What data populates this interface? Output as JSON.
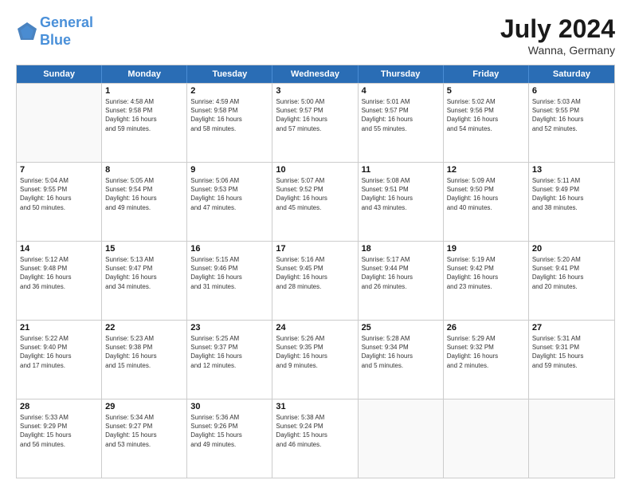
{
  "header": {
    "logo_line1": "General",
    "logo_line2": "Blue",
    "month": "July 2024",
    "location": "Wanna, Germany"
  },
  "days_of_week": [
    "Sunday",
    "Monday",
    "Tuesday",
    "Wednesday",
    "Thursday",
    "Friday",
    "Saturday"
  ],
  "weeks": [
    [
      {
        "day": "",
        "empty": true,
        "lines": []
      },
      {
        "day": "1",
        "lines": [
          "Sunrise: 4:58 AM",
          "Sunset: 9:58 PM",
          "Daylight: 16 hours",
          "and 59 minutes."
        ]
      },
      {
        "day": "2",
        "lines": [
          "Sunrise: 4:59 AM",
          "Sunset: 9:58 PM",
          "Daylight: 16 hours",
          "and 58 minutes."
        ]
      },
      {
        "day": "3",
        "lines": [
          "Sunrise: 5:00 AM",
          "Sunset: 9:57 PM",
          "Daylight: 16 hours",
          "and 57 minutes."
        ]
      },
      {
        "day": "4",
        "lines": [
          "Sunrise: 5:01 AM",
          "Sunset: 9:57 PM",
          "Daylight: 16 hours",
          "and 55 minutes."
        ]
      },
      {
        "day": "5",
        "lines": [
          "Sunrise: 5:02 AM",
          "Sunset: 9:56 PM",
          "Daylight: 16 hours",
          "and 54 minutes."
        ]
      },
      {
        "day": "6",
        "lines": [
          "Sunrise: 5:03 AM",
          "Sunset: 9:55 PM",
          "Daylight: 16 hours",
          "and 52 minutes."
        ]
      }
    ],
    [
      {
        "day": "7",
        "lines": [
          "Sunrise: 5:04 AM",
          "Sunset: 9:55 PM",
          "Daylight: 16 hours",
          "and 50 minutes."
        ]
      },
      {
        "day": "8",
        "lines": [
          "Sunrise: 5:05 AM",
          "Sunset: 9:54 PM",
          "Daylight: 16 hours",
          "and 49 minutes."
        ]
      },
      {
        "day": "9",
        "lines": [
          "Sunrise: 5:06 AM",
          "Sunset: 9:53 PM",
          "Daylight: 16 hours",
          "and 47 minutes."
        ]
      },
      {
        "day": "10",
        "lines": [
          "Sunrise: 5:07 AM",
          "Sunset: 9:52 PM",
          "Daylight: 16 hours",
          "and 45 minutes."
        ]
      },
      {
        "day": "11",
        "lines": [
          "Sunrise: 5:08 AM",
          "Sunset: 9:51 PM",
          "Daylight: 16 hours",
          "and 43 minutes."
        ]
      },
      {
        "day": "12",
        "lines": [
          "Sunrise: 5:09 AM",
          "Sunset: 9:50 PM",
          "Daylight: 16 hours",
          "and 40 minutes."
        ]
      },
      {
        "day": "13",
        "lines": [
          "Sunrise: 5:11 AM",
          "Sunset: 9:49 PM",
          "Daylight: 16 hours",
          "and 38 minutes."
        ]
      }
    ],
    [
      {
        "day": "14",
        "lines": [
          "Sunrise: 5:12 AM",
          "Sunset: 9:48 PM",
          "Daylight: 16 hours",
          "and 36 minutes."
        ]
      },
      {
        "day": "15",
        "lines": [
          "Sunrise: 5:13 AM",
          "Sunset: 9:47 PM",
          "Daylight: 16 hours",
          "and 34 minutes."
        ]
      },
      {
        "day": "16",
        "lines": [
          "Sunrise: 5:15 AM",
          "Sunset: 9:46 PM",
          "Daylight: 16 hours",
          "and 31 minutes."
        ]
      },
      {
        "day": "17",
        "lines": [
          "Sunrise: 5:16 AM",
          "Sunset: 9:45 PM",
          "Daylight: 16 hours",
          "and 28 minutes."
        ]
      },
      {
        "day": "18",
        "lines": [
          "Sunrise: 5:17 AM",
          "Sunset: 9:44 PM",
          "Daylight: 16 hours",
          "and 26 minutes."
        ]
      },
      {
        "day": "19",
        "lines": [
          "Sunrise: 5:19 AM",
          "Sunset: 9:42 PM",
          "Daylight: 16 hours",
          "and 23 minutes."
        ]
      },
      {
        "day": "20",
        "lines": [
          "Sunrise: 5:20 AM",
          "Sunset: 9:41 PM",
          "Daylight: 16 hours",
          "and 20 minutes."
        ]
      }
    ],
    [
      {
        "day": "21",
        "lines": [
          "Sunrise: 5:22 AM",
          "Sunset: 9:40 PM",
          "Daylight: 16 hours",
          "and 17 minutes."
        ]
      },
      {
        "day": "22",
        "lines": [
          "Sunrise: 5:23 AM",
          "Sunset: 9:38 PM",
          "Daylight: 16 hours",
          "and 15 minutes."
        ]
      },
      {
        "day": "23",
        "lines": [
          "Sunrise: 5:25 AM",
          "Sunset: 9:37 PM",
          "Daylight: 16 hours",
          "and 12 minutes."
        ]
      },
      {
        "day": "24",
        "lines": [
          "Sunrise: 5:26 AM",
          "Sunset: 9:35 PM",
          "Daylight: 16 hours",
          "and 9 minutes."
        ]
      },
      {
        "day": "25",
        "lines": [
          "Sunrise: 5:28 AM",
          "Sunset: 9:34 PM",
          "Daylight: 16 hours",
          "and 5 minutes."
        ]
      },
      {
        "day": "26",
        "lines": [
          "Sunrise: 5:29 AM",
          "Sunset: 9:32 PM",
          "Daylight: 16 hours",
          "and 2 minutes."
        ]
      },
      {
        "day": "27",
        "lines": [
          "Sunrise: 5:31 AM",
          "Sunset: 9:31 PM",
          "Daylight: 15 hours",
          "and 59 minutes."
        ]
      }
    ],
    [
      {
        "day": "28",
        "lines": [
          "Sunrise: 5:33 AM",
          "Sunset: 9:29 PM",
          "Daylight: 15 hours",
          "and 56 minutes."
        ]
      },
      {
        "day": "29",
        "lines": [
          "Sunrise: 5:34 AM",
          "Sunset: 9:27 PM",
          "Daylight: 15 hours",
          "and 53 minutes."
        ]
      },
      {
        "day": "30",
        "lines": [
          "Sunrise: 5:36 AM",
          "Sunset: 9:26 PM",
          "Daylight: 15 hours",
          "and 49 minutes."
        ]
      },
      {
        "day": "31",
        "lines": [
          "Sunrise: 5:38 AM",
          "Sunset: 9:24 PM",
          "Daylight: 15 hours",
          "and 46 minutes."
        ]
      },
      {
        "day": "",
        "empty": true,
        "lines": []
      },
      {
        "day": "",
        "empty": true,
        "lines": []
      },
      {
        "day": "",
        "empty": true,
        "lines": []
      }
    ]
  ]
}
